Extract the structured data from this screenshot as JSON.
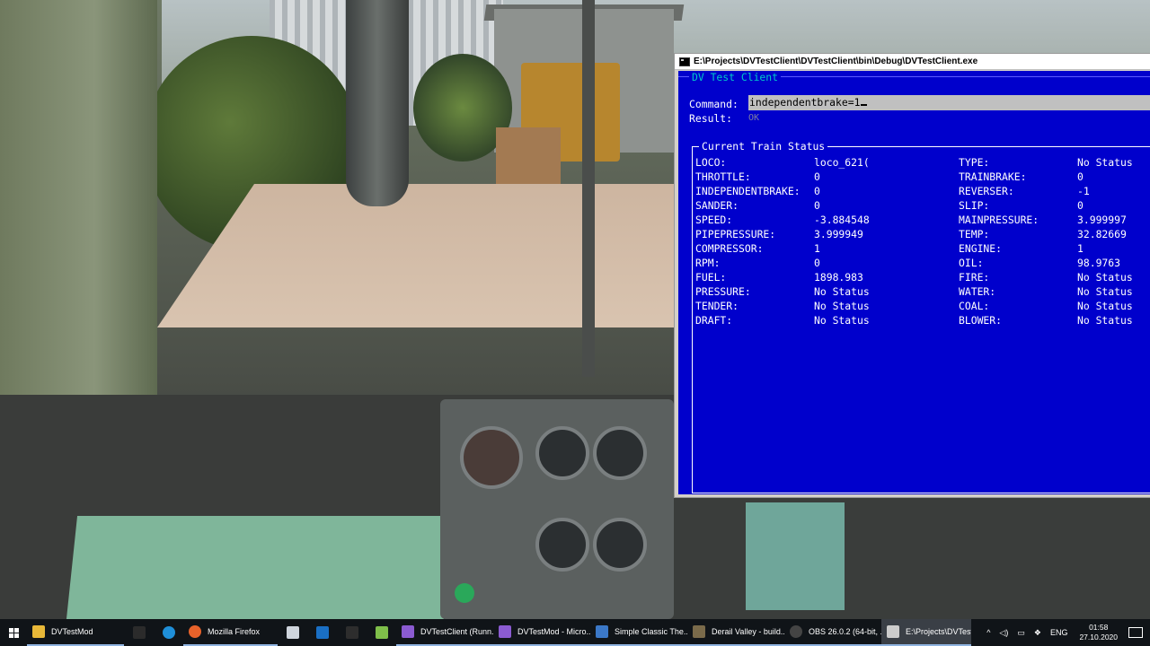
{
  "window": {
    "title": "E:\\Projects\\DVTestClient\\DVTestClient\\bin\\Debug\\DVTestClient.exe"
  },
  "app": {
    "title": "DV Test Client",
    "command_label": "Command:",
    "command_value": "independentbrake=1",
    "result_label": "Result:",
    "result_value": "OK",
    "status_title": "Current Train Status",
    "status_rows": [
      {
        "left_label": "LOCO:",
        "left_value": "loco_621(",
        "right_label": "TYPE:",
        "right_value": "No Status"
      },
      {
        "left_label": "THROTTLE:",
        "left_value": "0",
        "right_label": "TRAINBRAKE:",
        "right_value": "0"
      },
      {
        "left_label": "INDEPENDENTBRAKE:",
        "left_value": "0",
        "right_label": "REVERSER:",
        "right_value": "-1"
      },
      {
        "left_label": "SANDER:",
        "left_value": "0",
        "right_label": "SLIP:",
        "right_value": "0"
      },
      {
        "left_label": "SPEED:",
        "left_value": "-3.884548",
        "right_label": "MAINPRESSURE:",
        "right_value": "3.999997"
      },
      {
        "left_label": "PIPEPRESSURE:",
        "left_value": "3.999949",
        "right_label": "TEMP:",
        "right_value": "32.82669"
      },
      {
        "left_label": "COMPRESSOR:",
        "left_value": "1",
        "right_label": "ENGINE:",
        "right_value": "1"
      },
      {
        "left_label": "RPM:",
        "left_value": "0",
        "right_label": "OIL:",
        "right_value": "98.9763"
      },
      {
        "left_label": "FUEL:",
        "left_value": "1898.983",
        "right_label": "FIRE:",
        "right_value": "No Status"
      },
      {
        "left_label": "PRESSURE:",
        "left_value": "No Status",
        "right_label": "WATER:",
        "right_value": "No Status"
      },
      {
        "left_label": "TENDER:",
        "left_value": "No Status",
        "right_label": "COAL:",
        "right_value": "No Status"
      },
      {
        "left_label": "DRAFT:",
        "left_value": "No Status",
        "right_label": "BLOWER:",
        "right_value": "No Status"
      }
    ]
  },
  "taskbar": {
    "items": [
      {
        "name": "dvtestmod-folder",
        "label": "DVTestMod",
        "icon": "folder-icon",
        "color": "#e8b838"
      },
      {
        "name": "terminal",
        "label": "",
        "icon": "terminal-icon",
        "color": "#2b2b2b"
      },
      {
        "name": "edge",
        "label": "",
        "icon": "edge-icon",
        "color": "#1f8fd8"
      },
      {
        "name": "firefox",
        "label": "Mozilla Firefox",
        "icon": "firefox-icon",
        "color": "#e8622a"
      },
      {
        "name": "app-a",
        "label": "",
        "icon": "app-icon",
        "color": "#cfd5dd"
      },
      {
        "name": "outlook",
        "label": "",
        "icon": "outlook-icon",
        "color": "#1a6fc4"
      },
      {
        "name": "excel-x",
        "label": "",
        "icon": "x-icon",
        "color": "#2d2d2d"
      },
      {
        "name": "notepad-plus",
        "label": "",
        "icon": "notepad-icon",
        "color": "#7fbf4a"
      },
      {
        "name": "vs-running",
        "label": "DVTestClient (Runn...",
        "icon": "visual-studio-icon",
        "color": "#8b5bd1"
      },
      {
        "name": "vs-mod",
        "label": "DVTestMod - Micro...",
        "icon": "visual-studio-icon",
        "color": "#8b5bd1"
      },
      {
        "name": "simple-classic",
        "label": "Simple Classic The...",
        "icon": "window-icon",
        "color": "#3b78c8"
      },
      {
        "name": "derail-valley",
        "label": "Derail Valley - build...",
        "icon": "game-icon",
        "color": "#7a6a4a"
      },
      {
        "name": "obs",
        "label": "OBS 26.0.2 (64-bit, ...",
        "icon": "obs-icon",
        "color": "#444444"
      },
      {
        "name": "console",
        "label": "E:\\Projects\\DVTest...",
        "icon": "console-icon",
        "color": "#cccccc"
      }
    ],
    "tray": {
      "language": "ENG",
      "time": "01:58",
      "date": "27.10.2020"
    }
  }
}
